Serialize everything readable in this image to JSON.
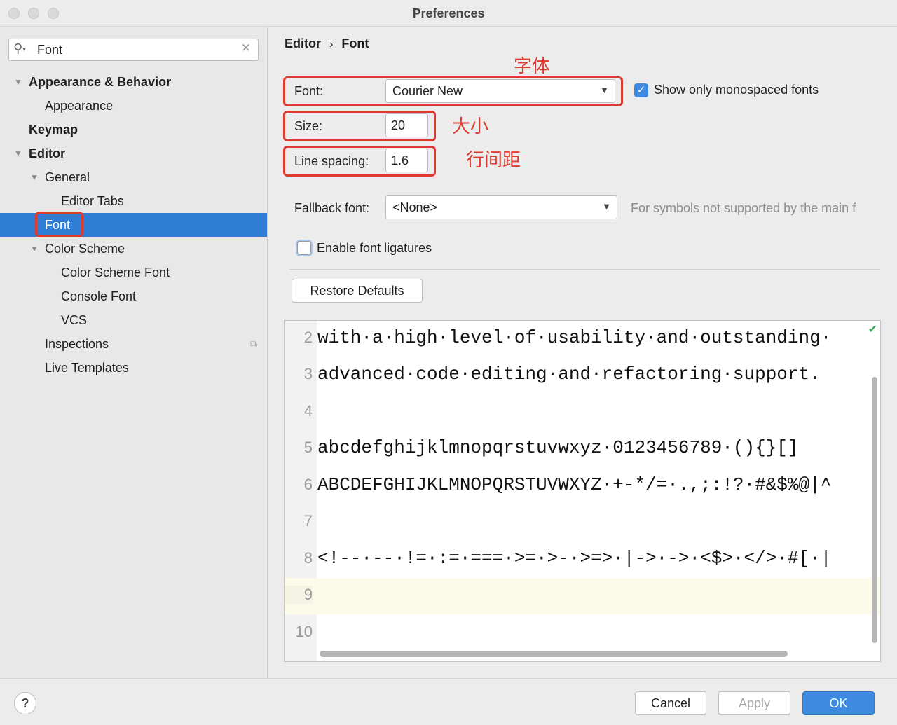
{
  "window": {
    "title": "Preferences"
  },
  "search": {
    "value": "Font"
  },
  "sidebar": {
    "items": [
      {
        "label": "Appearance & Behavior"
      },
      {
        "label": "Appearance"
      },
      {
        "label": "Keymap"
      },
      {
        "label": "Editor"
      },
      {
        "label": "General"
      },
      {
        "label": "Editor Tabs"
      },
      {
        "label": "Font"
      },
      {
        "label": "Color Scheme"
      },
      {
        "label": "Color Scheme Font"
      },
      {
        "label": "Console Font"
      },
      {
        "label": "VCS"
      },
      {
        "label": "Inspections"
      },
      {
        "label": "Live Templates"
      }
    ],
    "selected": "Font"
  },
  "breadcrumb": {
    "parent": "Editor",
    "separator": "›",
    "current": "Font"
  },
  "form": {
    "font_label": "Font:",
    "font_value": "Courier New",
    "monospaced_label": "Show only monospaced fonts",
    "monospaced_checked": true,
    "size_label": "Size:",
    "size_value": "20",
    "line_spacing_label": "Line spacing:",
    "line_spacing_value": "1.6",
    "fallback_label": "Fallback font:",
    "fallback_value": "<None>",
    "fallback_hint": "For symbols not supported by the main f",
    "ligatures_label": "Enable font ligatures",
    "ligatures_checked": false,
    "restore_label": "Restore Defaults"
  },
  "annotations": {
    "font": "字体",
    "size": "大小",
    "line_spacing": "行间距"
  },
  "preview": {
    "lines": [
      {
        "num": "2",
        "text": "with·a·high·level·of·usability·and·outstanding·"
      },
      {
        "num": "3",
        "text": "advanced·code·editing·and·refactoring·support."
      },
      {
        "num": "4",
        "text": ""
      },
      {
        "num": "5",
        "text": "abcdefghijklmnopqrstuvwxyz·0123456789·(){}[]"
      },
      {
        "num": "6",
        "text": "ABCDEFGHIJKLMNOPQRSTUVWXYZ·+-*/=·.,;:!?·#&$%@|^"
      },
      {
        "num": "7",
        "text": ""
      },
      {
        "num": "8",
        "text": "<!--·--·!=·:=·===·>=·>-·>=>·|->·->·<$>·</>·#[·|"
      },
      {
        "num": "9",
        "text": ""
      },
      {
        "num": "10",
        "text": ""
      }
    ],
    "current_line": "9"
  },
  "footer": {
    "help": "?",
    "cancel": "Cancel",
    "apply": "Apply",
    "ok": "OK"
  },
  "colors": {
    "accent": "#2f7dd4",
    "annotation": "#e03a2f"
  }
}
